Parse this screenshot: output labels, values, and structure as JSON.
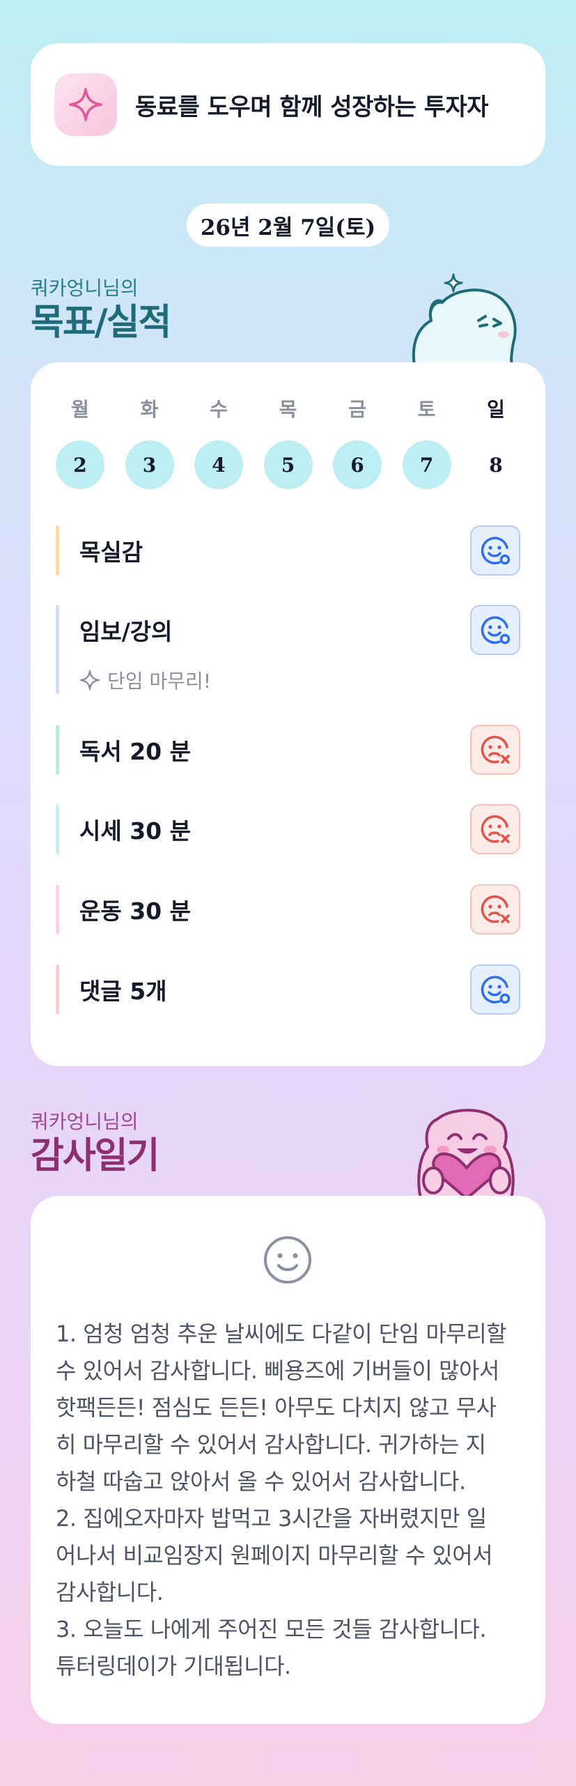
{
  "header": {
    "title": "동료를 도우며 함께 성장하는 투자자",
    "badge_icon": "sparkle-icon"
  },
  "date": "26년 2월 7일(토)",
  "goals_section": {
    "subtitle": "쿼카엉니님의",
    "title": "목표/실적"
  },
  "week": {
    "days": [
      {
        "label": "월",
        "num": "2",
        "highlighted": true
      },
      {
        "label": "화",
        "num": "3",
        "highlighted": true
      },
      {
        "label": "수",
        "num": "4",
        "highlighted": true
      },
      {
        "label": "목",
        "num": "5",
        "highlighted": true
      },
      {
        "label": "금",
        "num": "6",
        "highlighted": true
      },
      {
        "label": "토",
        "num": "7",
        "highlighted": true
      },
      {
        "label": "일",
        "num": "8",
        "highlighted": false
      }
    ]
  },
  "goals": [
    {
      "label": "목실감",
      "status": "done",
      "bar_color": "#f6dca8",
      "note": ""
    },
    {
      "label": "임보/강의",
      "status": "done",
      "bar_color": "#d4daf2",
      "note": "단임 마무리!"
    },
    {
      "label": "독서 20 분",
      "status": "missed",
      "bar_color": "#bfeadb",
      "note": ""
    },
    {
      "label": "시세 30 분",
      "status": "missed",
      "bar_color": "#c9eef0",
      "note": ""
    },
    {
      "label": "운동 30 분",
      "status": "missed",
      "bar_color": "#f7d3e7",
      "note": ""
    },
    {
      "label": "댓글 5개",
      "status": "done",
      "bar_color": "#f7d0d6",
      "note": ""
    }
  ],
  "gratitude_section": {
    "subtitle": "쿼카엉니님의",
    "title": "감사일기",
    "icon": "smile-face-icon",
    "text": "1. 엄청 엄청 추운 날씨에도 다같이 단임 마무리할\n수 있어서 감사합니다. 삐용즈에 기버들이 많아서\n핫팩든든! 점심도 든든! 아무도 다치지 않고 무사\n히 마무리할 수 있어서 감사합니다. 귀가하는 지\n하철 따숩고 앉아서 올 수 있어서 감사합니다.\n2. 집에오자마자 밥먹고 3시간을 자버렸지만 일\n어나서 비교임장지 원페이지 마무리할 수 있어서\n감사합니다.\n3. 오늘도 나에게 주어진 모든 것들 감사합니다.\n튜터링데이가 기대됩니다."
  },
  "colors": {
    "done": "#2f6ee8",
    "missed": "#e0534a",
    "highlight": "#bdeef3"
  }
}
